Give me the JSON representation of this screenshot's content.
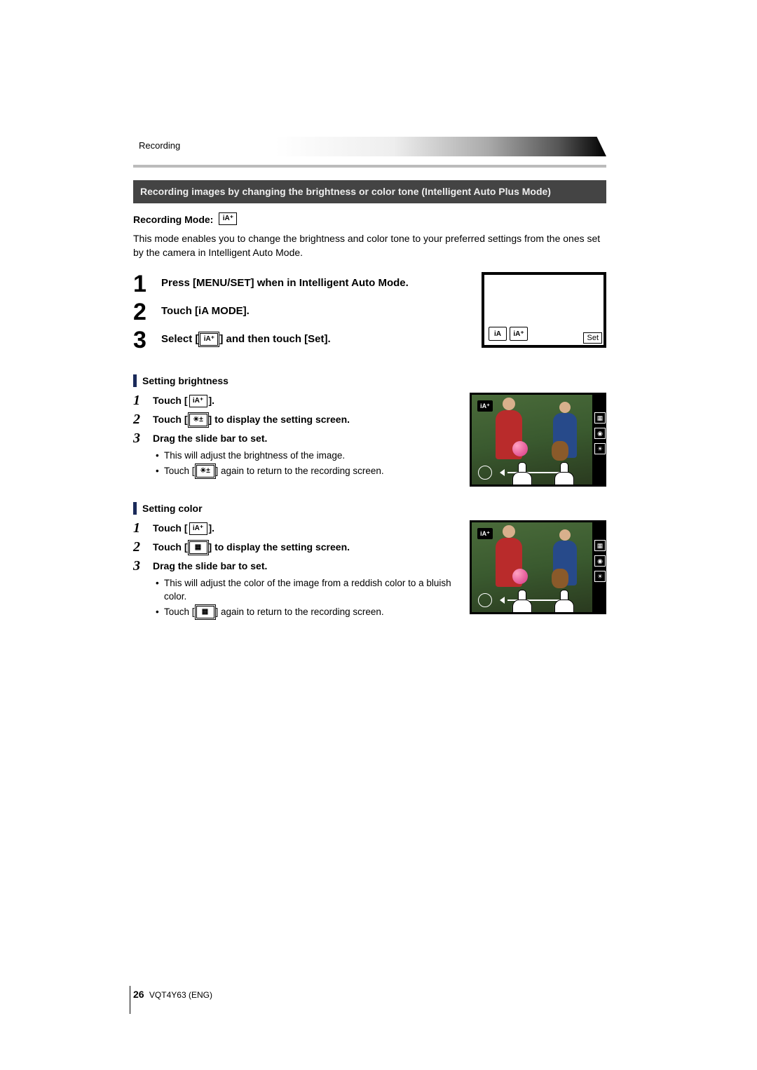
{
  "header": {
    "breadcrumb": "Recording"
  },
  "section_title": "Recording images by changing the brightness or color tone (Intelligent Auto Plus Mode)",
  "rec_mode": {
    "label": "Recording Mode: ",
    "icon": "iA⁺"
  },
  "intro": "This mode enables you to change the brightness and color tone to your preferred settings from the ones set by the camera in Intelligent Auto Mode.",
  "main_steps": [
    {
      "num": "1",
      "text": "Press [MENU/SET] when in Intelligent Auto Mode."
    },
    {
      "num": "2",
      "text": "Touch [iA MODE]."
    },
    {
      "num": "3",
      "prefix": "Select [",
      "icon": "iA⁺",
      "suffix": "] and then touch [Set]."
    }
  ],
  "fig1": {
    "ia": "iA",
    "ia_plus": "iA⁺",
    "set": "Set"
  },
  "brightness": {
    "heading": "Setting brightness",
    "steps": [
      {
        "num": "1",
        "prefix": "Touch [",
        "icon": "iA⁺",
        "suffix": "]."
      },
      {
        "num": "2",
        "prefix": "Touch [",
        "icon": "☀±",
        "suffix": "] to display the setting screen."
      },
      {
        "num": "3",
        "text": "Drag the slide bar to set."
      }
    ],
    "bullets": [
      {
        "text": "This will adjust the brightness of the image."
      },
      {
        "prefix": "Touch [",
        "icon": "☀±",
        "suffix": "] again to return to the recording screen."
      }
    ],
    "fig": {
      "badge": "iA⁺",
      "side": [
        "▦",
        "◉",
        "☀"
      ]
    }
  },
  "color": {
    "heading": "Setting color",
    "steps": [
      {
        "num": "1",
        "prefix": "Touch [",
        "icon": "iA⁺",
        "suffix": "]."
      },
      {
        "num": "2",
        "prefix": "Touch [",
        "icon": "▦",
        "suffix": "] to display the setting screen."
      },
      {
        "num": "3",
        "text": "Drag the slide bar to set."
      }
    ],
    "bullets": [
      {
        "text": "This will adjust the color of the image from a reddish color to a bluish color."
      },
      {
        "prefix": "Touch [",
        "icon": "▦",
        "suffix": "] again to return to the recording screen."
      }
    ],
    "fig": {
      "badge": "iA⁺",
      "side": [
        "▦",
        "◉",
        "☀"
      ]
    }
  },
  "footer": {
    "page": "26",
    "doc": "VQT4Y63 (ENG)"
  }
}
